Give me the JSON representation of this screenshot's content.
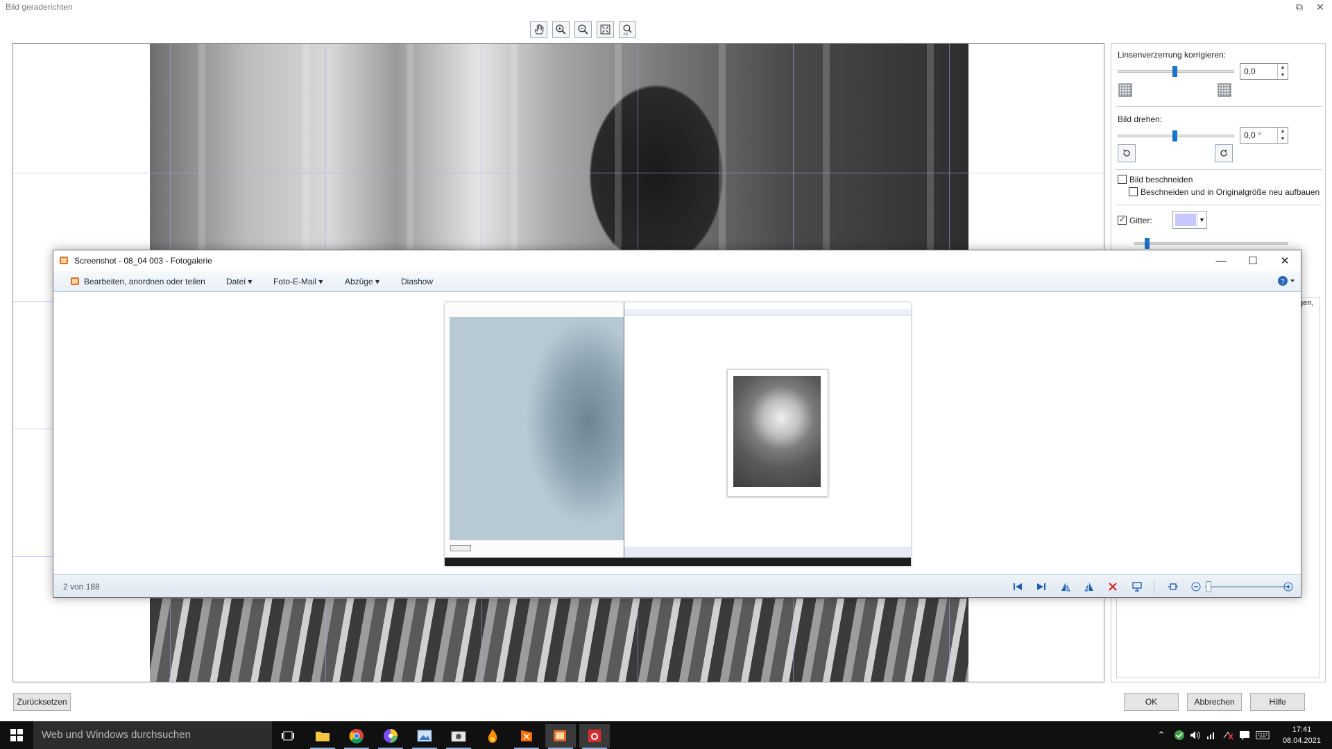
{
  "background_dialog": {
    "title": "Bild geraderichten",
    "toolbar": [
      "hand-icon",
      "zoom-in-icon",
      "zoom-out-icon",
      "fit-icon",
      "actual-size-icon"
    ],
    "panel": {
      "lens_label": "Linsenverzerrung korrigieren:",
      "lens_value": "0,0",
      "rotate_label": "Bild drehen:",
      "rotate_value": "0,0 °",
      "crop_label": "Bild beschneiden",
      "crop_checked": false,
      "crop_resize_label": "Beschneiden und in Originalgröße neu aufbauen",
      "crop_resize_checked": false,
      "grid_label": "Gitter:",
      "grid_checked": true,
      "grid_color": "#c8c8ff",
      "partial_text": "gen,"
    },
    "buttons": {
      "reset": "Zurücksetzen",
      "ok": "OK",
      "cancel": "Abbrechen",
      "help": "Hilfe"
    }
  },
  "gallery": {
    "title": "Screenshot - 08_04 003 - Fotogalerie",
    "menu": {
      "edit": "Bearbeiten, anordnen oder teilen",
      "file": "Datei",
      "email": "Foto-E-Mail",
      "prints": "Abzüge",
      "slideshow": "Diashow"
    },
    "status": "2 von 188"
  },
  "taskbar": {
    "search_placeholder": "Web und Windows durchsuchen",
    "time": "17:41",
    "date": "08.04.2021"
  }
}
